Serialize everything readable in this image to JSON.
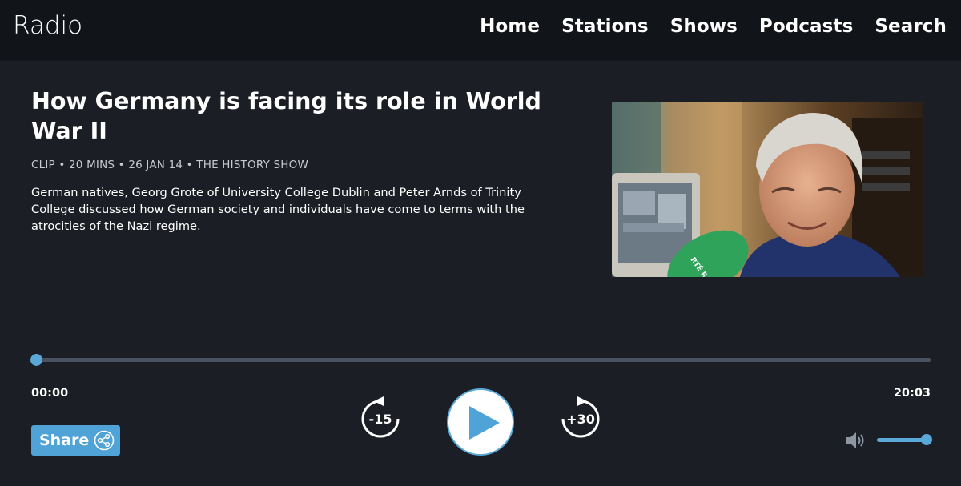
{
  "brand": "Radio",
  "nav": [
    "Home",
    "Stations",
    "Shows",
    "Podcasts",
    "Search"
  ],
  "episode": {
    "title": "How Germany is facing its role in World War II",
    "meta": "CLIP • 20 MINS • 26 JAN 14 • THE HISTORY SHOW",
    "description": "German natives, Georg Grote of University College Dublin and Peter Arnds of Trinity College discussed how German society and individuals have come to terms with the atrocities of the Nazi regime.",
    "mic_text": "RTÉ RADIO"
  },
  "player": {
    "current_time": "00:00",
    "duration": "20:03",
    "progress": 0.0,
    "skip_back_label": "-15",
    "skip_forward_label": "+30",
    "volume": 1.0,
    "accent_color": "#5aa8d8"
  },
  "share": {
    "label": "Share"
  },
  "icons": [
    "skip-back-icon",
    "play-icon",
    "skip-forward-icon",
    "share-icon",
    "volume-icon"
  ]
}
